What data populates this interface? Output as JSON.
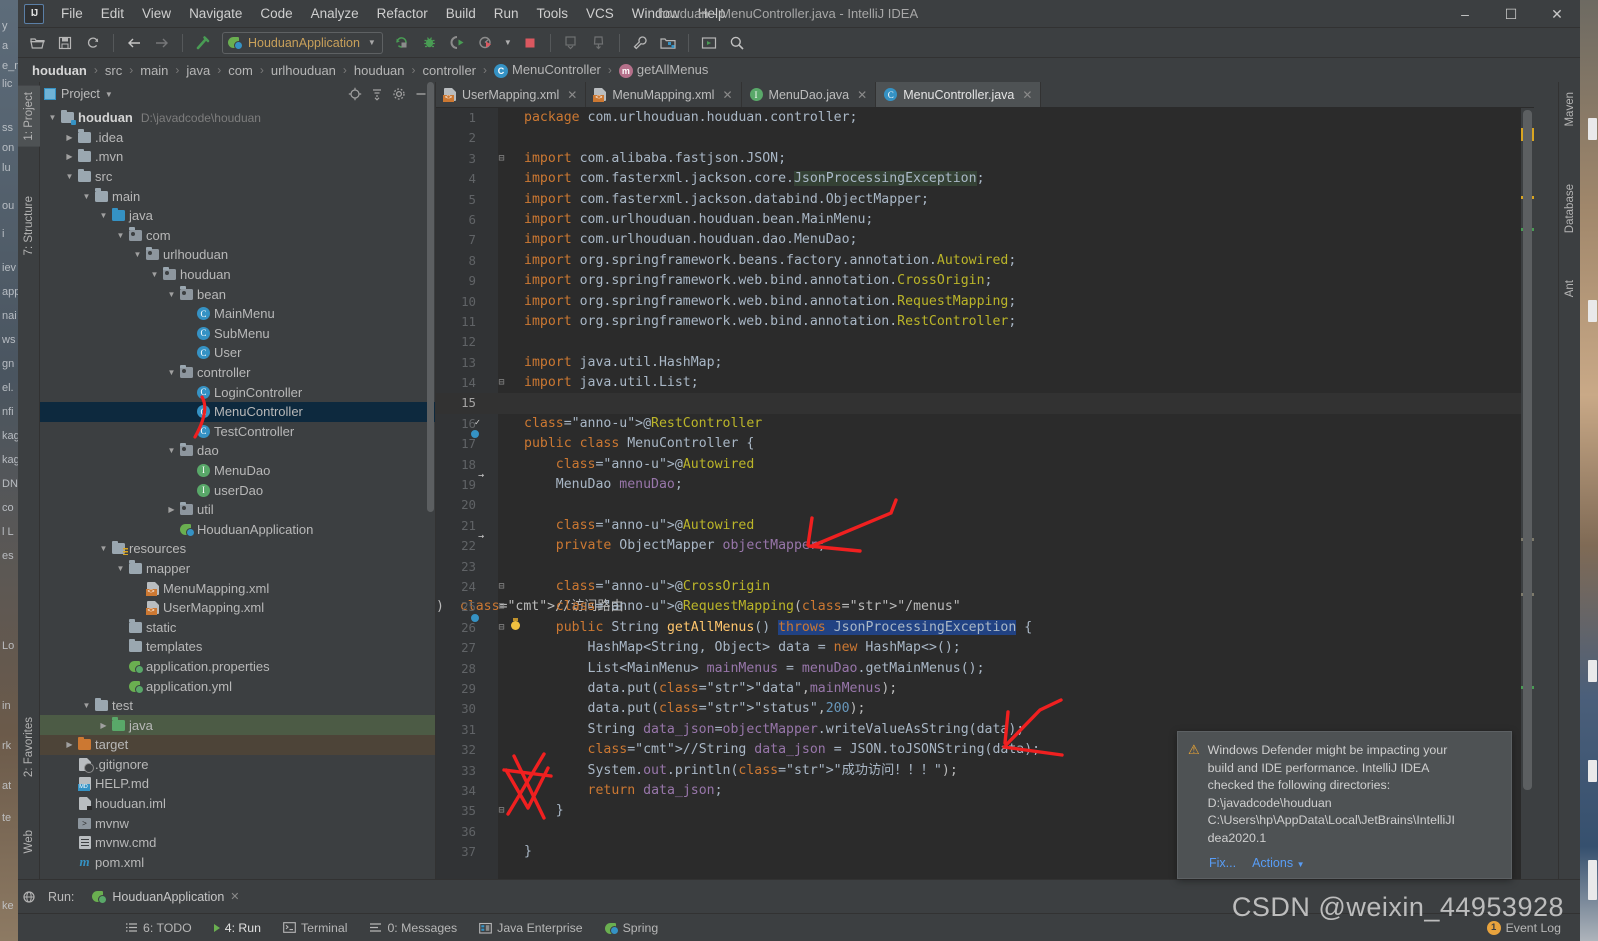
{
  "window": {
    "title": "houduan - MenuController.java - IntelliJ IDEA",
    "logo": "IJ",
    "minimize": "–",
    "maximize": "☐",
    "close": "✕"
  },
  "menubar": {
    "items": [
      {
        "label": "File"
      },
      {
        "label": "Edit"
      },
      {
        "label": "View"
      },
      {
        "label": "Navigate"
      },
      {
        "label": "Code"
      },
      {
        "label": "Analyze"
      },
      {
        "label": "Refactor"
      },
      {
        "label": "Build"
      },
      {
        "label": "Run"
      },
      {
        "label": "Tools"
      },
      {
        "label": "VCS"
      },
      {
        "label": "Window"
      },
      {
        "label": "Help"
      }
    ]
  },
  "toolbar": {
    "run_config": "HouduanApplication",
    "icons": [
      "open-folder-icon",
      "save-all-icon",
      "sync-icon",
      "back-arrow-icon",
      "forward-arrow-icon",
      "build-hammer-icon",
      "rerun-icon",
      "debug-icon",
      "run-with-coverage-icon",
      "profiler-icon",
      "stop-icon",
      "update-project-icon",
      "commit-icon",
      "settings-wrench-icon",
      "project-structure-icon",
      "select-in-icon",
      "search-everywhere-icon"
    ]
  },
  "breadcrumb": {
    "items": [
      {
        "label": "houduan",
        "bold": true
      },
      {
        "label": "src"
      },
      {
        "label": "main"
      },
      {
        "label": "java"
      },
      {
        "label": "com"
      },
      {
        "label": "urlhouduan"
      },
      {
        "label": "houduan"
      },
      {
        "label": "controller"
      },
      {
        "label": "MenuController",
        "icon": "class-icon",
        "icon_char": "C",
        "icon_color": "#3592c4"
      },
      {
        "label": "getAllMenus",
        "icon": "method-icon",
        "icon_char": "m",
        "icon_color": "#b5708a"
      }
    ],
    "separator": "〉"
  },
  "left_tool_strip": {
    "tabs": [
      {
        "label": "1: Project",
        "selected": true
      },
      {
        "label": "7: Structure",
        "selected": false
      },
      {
        "label": "2: Favorites",
        "selected": false
      },
      {
        "label": "Web",
        "selected": false
      }
    ]
  },
  "right_tool_strip": {
    "tabs": [
      {
        "label": "Maven"
      },
      {
        "label": "Database"
      },
      {
        "label": "Ant"
      }
    ]
  },
  "project_panel": {
    "title": "Project",
    "dropdown_caret": "▼",
    "actions": [
      "locate-icon",
      "collapse-all-icon",
      "settings-gear-icon",
      "hide-icon"
    ],
    "tree": [
      {
        "depth": 0,
        "arrow": "▼",
        "icon": "module-folder-icon",
        "label": "houduan",
        "sub": "D:\\javadcode\\houduan",
        "bold": true
      },
      {
        "depth": 1,
        "arrow": "▶",
        "icon": "folder-icon",
        "label": ".idea"
      },
      {
        "depth": 1,
        "arrow": "▶",
        "icon": "folder-icon",
        "label": ".mvn"
      },
      {
        "depth": 1,
        "arrow": "▼",
        "icon": "folder-icon",
        "label": "src"
      },
      {
        "depth": 2,
        "arrow": "▼",
        "icon": "folder-icon",
        "label": "main"
      },
      {
        "depth": 3,
        "arrow": "▼",
        "icon": "source-folder-icon",
        "label": "java"
      },
      {
        "depth": 4,
        "arrow": "▼",
        "icon": "package-icon",
        "label": "com"
      },
      {
        "depth": 5,
        "arrow": "▼",
        "icon": "package-icon",
        "label": "urlhouduan"
      },
      {
        "depth": 6,
        "arrow": "▼",
        "icon": "package-icon",
        "label": "houduan"
      },
      {
        "depth": 7,
        "arrow": "▼",
        "icon": "package-icon",
        "label": "bean"
      },
      {
        "depth": 8,
        "arrow": "",
        "icon": "class-icon",
        "label": "MainMenu"
      },
      {
        "depth": 8,
        "arrow": "",
        "icon": "class-icon",
        "label": "SubMenu"
      },
      {
        "depth": 8,
        "arrow": "",
        "icon": "class-icon",
        "label": "User"
      },
      {
        "depth": 7,
        "arrow": "▼",
        "icon": "package-icon",
        "label": "controller"
      },
      {
        "depth": 8,
        "arrow": "",
        "icon": "class-icon",
        "label": "LoginController"
      },
      {
        "depth": 8,
        "arrow": "",
        "icon": "class-icon",
        "label": "MenuController",
        "selected": true
      },
      {
        "depth": 8,
        "arrow": "",
        "icon": "class-icon",
        "label": "TestController"
      },
      {
        "depth": 7,
        "arrow": "▼",
        "icon": "package-icon",
        "label": "dao"
      },
      {
        "depth": 8,
        "arrow": "",
        "icon": "interface-icon",
        "label": "MenuDao"
      },
      {
        "depth": 8,
        "arrow": "",
        "icon": "interface-icon",
        "label": "userDao"
      },
      {
        "depth": 7,
        "arrow": "▶",
        "icon": "package-icon",
        "label": "util"
      },
      {
        "depth": 7,
        "arrow": "",
        "icon": "spring-boot-icon",
        "label": "HouduanApplication"
      },
      {
        "depth": 3,
        "arrow": "▼",
        "icon": "resources-folder-icon",
        "label": "resources"
      },
      {
        "depth": 4,
        "arrow": "▼",
        "icon": "folder-icon",
        "label": "mapper"
      },
      {
        "depth": 5,
        "arrow": "",
        "icon": "xml-file-icon",
        "label": "MenuMapping.xml"
      },
      {
        "depth": 5,
        "arrow": "",
        "icon": "xml-file-icon",
        "label": "UserMapping.xml"
      },
      {
        "depth": 4,
        "arrow": "",
        "icon": "folder-icon",
        "label": "static"
      },
      {
        "depth": 4,
        "arrow": "",
        "icon": "folder-icon",
        "label": "templates"
      },
      {
        "depth": 4,
        "arrow": "",
        "icon": "spring-config-icon",
        "label": "application.properties"
      },
      {
        "depth": 4,
        "arrow": "",
        "icon": "spring-config-icon",
        "label": "application.yml"
      },
      {
        "depth": 2,
        "arrow": "▼",
        "icon": "folder-icon",
        "label": "test"
      },
      {
        "depth": 3,
        "arrow": "▶",
        "icon": "test-source-folder-icon",
        "label": "java",
        "rowbg": "green"
      },
      {
        "depth": 1,
        "arrow": "▶",
        "icon": "excluded-folder-icon",
        "label": "target",
        "rowbg": "brown"
      },
      {
        "depth": 1,
        "arrow": "",
        "icon": "gitignore-file-icon",
        "label": ".gitignore"
      },
      {
        "depth": 1,
        "arrow": "",
        "icon": "markdown-file-icon",
        "label": "HELP.md"
      },
      {
        "depth": 1,
        "arrow": "",
        "icon": "iml-file-icon",
        "label": "houduan.iml"
      },
      {
        "depth": 1,
        "arrow": "",
        "icon": "shell-script-icon",
        "label": "mvnw"
      },
      {
        "depth": 1,
        "arrow": "",
        "icon": "cmd-file-icon",
        "label": "mvnw.cmd"
      },
      {
        "depth": 1,
        "arrow": "",
        "icon": "maven-pom-icon",
        "label": "pom.xml"
      }
    ]
  },
  "editor": {
    "tabs": [
      {
        "label": "UserMapping.xml",
        "icon": "xml-file-icon",
        "active": false,
        "close": "✕"
      },
      {
        "label": "MenuMapping.xml",
        "icon": "xml-file-icon",
        "active": false,
        "close": "✕"
      },
      {
        "label": "MenuDao.java",
        "icon": "interface-icon",
        "active": false,
        "close": "✕"
      },
      {
        "label": "MenuController.java",
        "icon": "class-icon",
        "active": true,
        "close": "✕"
      }
    ],
    "lines": [
      {
        "n": 1,
        "text": "package com.urlhouduan.houduan.controller;"
      },
      {
        "n": 2,
        "text": ""
      },
      {
        "n": 3,
        "text": "import com.alibaba.fastjson.JSON;"
      },
      {
        "n": 4,
        "text": "import com.fasterxml.jackson.core.JsonProcessingException;"
      },
      {
        "n": 5,
        "text": "import com.fasterxml.jackson.databind.ObjectMapper;"
      },
      {
        "n": 6,
        "text": "import com.urlhouduan.houduan.bean.MainMenu;"
      },
      {
        "n": 7,
        "text": "import com.urlhouduan.houduan.dao.MenuDao;"
      },
      {
        "n": 8,
        "text": "import org.springframework.beans.factory.annotation.Autowired;"
      },
      {
        "n": 9,
        "text": "import org.springframework.web.bind.annotation.CrossOrigin;"
      },
      {
        "n": 10,
        "text": "import org.springframework.web.bind.annotation.RequestMapping;"
      },
      {
        "n": 11,
        "text": "import org.springframework.web.bind.annotation.RestController;"
      },
      {
        "n": 12,
        "text": ""
      },
      {
        "n": 13,
        "text": "import java.util.HashMap;"
      },
      {
        "n": 14,
        "text": "import java.util.List;"
      },
      {
        "n": 15,
        "text": ""
      },
      {
        "n": 16,
        "text": "@RestController"
      },
      {
        "n": 17,
        "text": "public class MenuController {"
      },
      {
        "n": 18,
        "text": "    @Autowired"
      },
      {
        "n": 19,
        "text": "    MenuDao menuDao;"
      },
      {
        "n": 20,
        "text": ""
      },
      {
        "n": 21,
        "text": "    @Autowired"
      },
      {
        "n": 22,
        "text": "    private ObjectMapper objectMapper;"
      },
      {
        "n": 23,
        "text": ""
      },
      {
        "n": 24,
        "text": "    @CrossOrigin"
      },
      {
        "n": 25,
        "text": "    @RequestMapping(\"/menus\")  //访问路由"
      },
      {
        "n": 26,
        "text": "    public String getAllMenus() throws JsonProcessingException {"
      },
      {
        "n": 27,
        "text": "        HashMap<String, Object> data = new HashMap<>();"
      },
      {
        "n": 28,
        "text": "        List<MainMenu> mainMenus = menuDao.getMainMenus();"
      },
      {
        "n": 29,
        "text": "        data.put(\"data\",mainMenus);"
      },
      {
        "n": 30,
        "text": "        data.put(\"status\",200);"
      },
      {
        "n": 31,
        "text": "        String data_json=objectMapper.writeValueAsString(data);"
      },
      {
        "n": 32,
        "text": "        //String data_json = JSON.toJSONString(data);"
      },
      {
        "n": 33,
        "text": "        System.out.println(\"成功访问！！！\");"
      },
      {
        "n": 34,
        "text": "        return data_json;"
      },
      {
        "n": 35,
        "text": "    }"
      },
      {
        "n": 36,
        "text": ""
      },
      {
        "n": 37,
        "text": "}"
      }
    ]
  },
  "notification": {
    "icon": "warning-triangle-icon",
    "text": "Windows Defender might be impacting your build and IDE performance. IntelliJ IDEA checked the following directories: D:\\javadcode\\houduan C:\\Users\\hp\\AppData\\Local\\JetBrains\\IntelliJIdea2020.1",
    "lines": [
      "Windows Defender might be impacting your",
      "build and IDE performance. IntelliJ IDEA",
      "checked the following directories:",
      "D:\\javadcode\\houduan",
      "C:\\Users\\hp\\AppData\\Local\\JetBrains\\IntelliJI",
      "dea2020.1"
    ],
    "fix_label": "Fix...",
    "actions_label": "Actions",
    "actions_caret": "▼"
  },
  "run_panel": {
    "run_label": "Run:",
    "tab_label": "HouduanApplication",
    "close": "✕"
  },
  "statusbar": {
    "items": [
      {
        "label": "6: TODO",
        "icon": "todo-icon"
      },
      {
        "label": "4: Run",
        "icon": "run-icon",
        "strong": true
      },
      {
        "label": "Terminal",
        "icon": "terminal-icon"
      },
      {
        "label": "0: Messages",
        "icon": "messages-icon"
      },
      {
        "label": "Java Enterprise",
        "icon": "java-enterprise-icon"
      },
      {
        "label": "Spring",
        "icon": "spring-icon"
      }
    ],
    "event_log": {
      "label": "Event Log",
      "count": "1"
    }
  },
  "watermark": "CSDN @weixin_44953928",
  "colors": {
    "accent_blue": "#3592c4",
    "selection_blue": "#0d293e",
    "keyword_orange": "#cc7832",
    "string_green": "#6a8759",
    "comment_green": "#629755",
    "annotation_yellow": "#bbb529",
    "number_blue": "#6897bb",
    "field_purple": "#9876aa",
    "method_yellow": "#ffc66d",
    "editor_bg": "#2b2b2b",
    "panel_bg": "#3c3f41",
    "annotation_red": "#f02020"
  }
}
